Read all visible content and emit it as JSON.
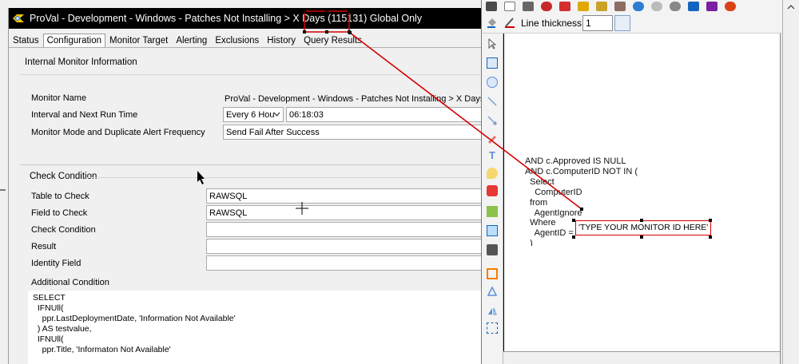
{
  "window": {
    "title": "ProVal - Development - Windows - Patches Not Installing > X Days (115131) Global Only"
  },
  "tabs": [
    {
      "label": "Status"
    },
    {
      "label": "Configuration",
      "active": true
    },
    {
      "label": "Monitor Target"
    },
    {
      "label": "Alerting"
    },
    {
      "label": "Exclusions"
    },
    {
      "label": "History"
    },
    {
      "label": "Query Results"
    }
  ],
  "internal_info": {
    "group_label": "Internal Monitor Information",
    "monitor_name_label": "Monitor Name",
    "monitor_name_value": "ProVal - Development - Windows - Patches Not Installing > X Days",
    "interval_label": "Interval and Next Run Time",
    "interval_value": "Every 6 Hou",
    "next_run_time": "06:18:03",
    "mode_label": "Monitor Mode and Duplicate Alert Frequency",
    "mode_value": "Send Fail After Success"
  },
  "check_condition": {
    "group_label": "Check Condition",
    "table_label": "Table to Check",
    "table_value": "RAWSQL",
    "field_label": "Field to Check",
    "field_value": "RAWSQL",
    "condition_label": "Check Condition",
    "condition_value": "",
    "result_label": "Result",
    "result_value": "",
    "identity_label": "Identity Field",
    "identity_value": "",
    "additional_label": "Additional Condition",
    "additional_sql": "SELECT\n  IFNUll(\n    ppr.LastDeploymentDate, 'Information Not Available'\n  ) AS testvalue,\n  IFNUll(\n    ppr.Title, 'Informaton Not Available'"
  },
  "editor": {
    "line_thickness_label": "Line thickness",
    "line_thickness_value": "1",
    "code_snippet": "AND c.Approved IS NULL\nAND c.ComputerID NOT IN (\n  Select\n    ComputerID\n  from\n    AgentIgnore\n  Where\n    AgentID =\n  )\nHAVING",
    "monitor_id_placeholder": "'TYPE YOUR MONITOR ID HERE'"
  },
  "colors": {
    "titlebar": "#000000",
    "annotation": "#d40000"
  }
}
